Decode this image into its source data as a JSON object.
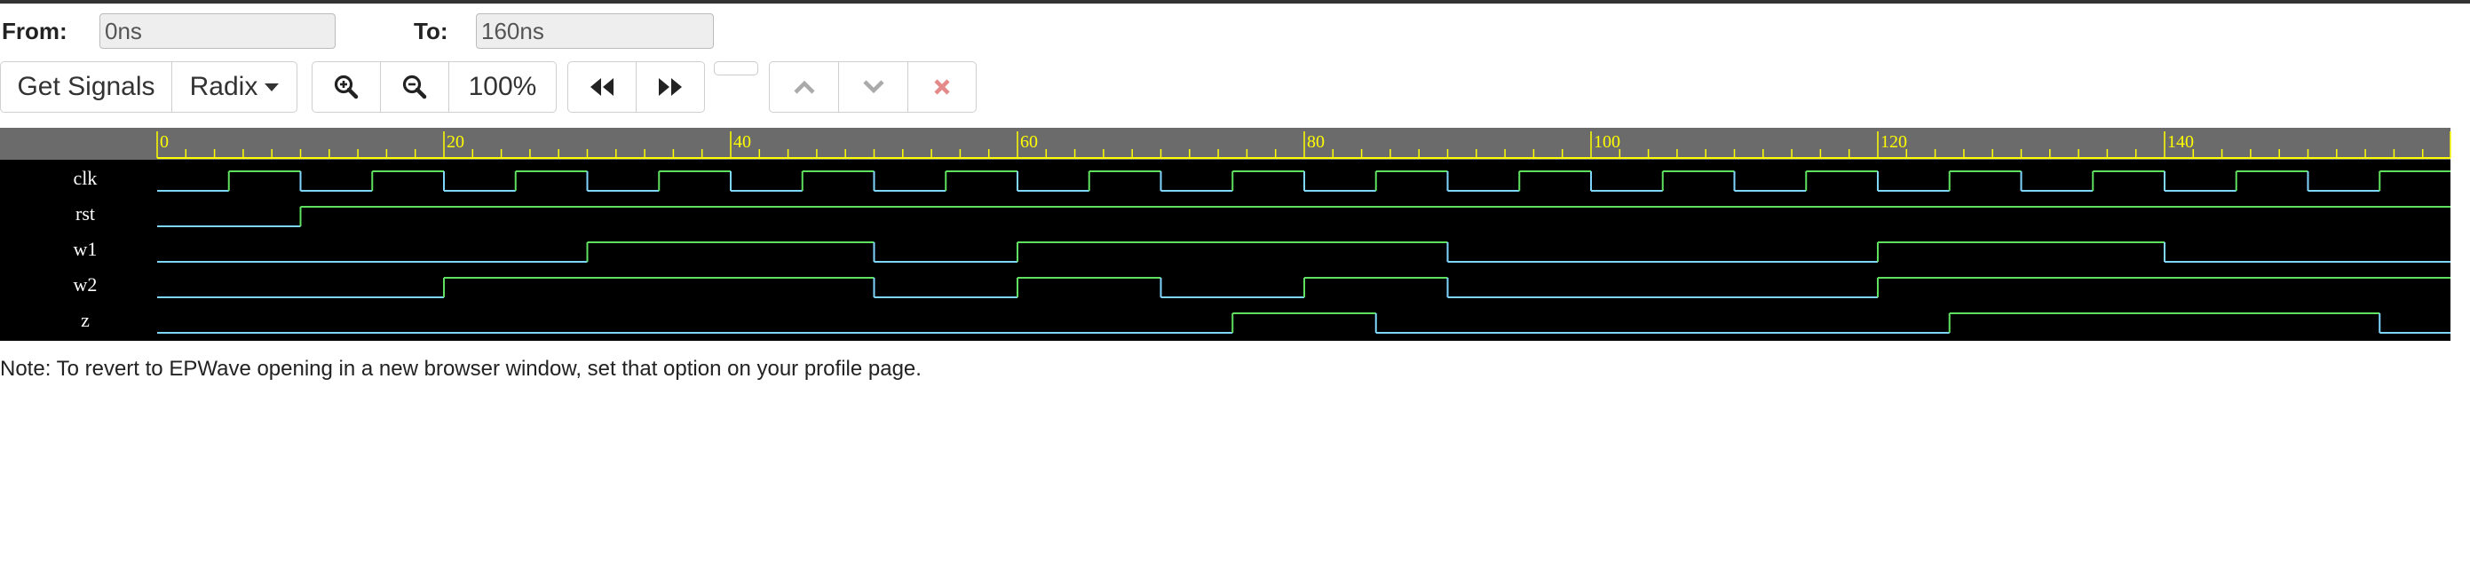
{
  "range": {
    "from_label": "From:",
    "from_value": "0ns",
    "to_label": "To:",
    "to_value": "160ns"
  },
  "toolbar": {
    "get_signals_label": "Get Signals",
    "radix_label": "Radix",
    "zoom_level": "100%",
    "icons": {
      "zoom_in": "zoom-in-icon",
      "zoom_out": "zoom-out-icon",
      "rewind": "fast-backward-icon",
      "forward": "fast-forward-icon",
      "prev": "chevron-up-icon",
      "next": "chevron-down-icon",
      "clear": "close-icon"
    }
  },
  "waveform": {
    "time_unit": "ns",
    "time_end": 160,
    "ruler_labels": [
      "0",
      "20",
      "40",
      "60",
      "80",
      "100",
      "120",
      "140"
    ],
    "colors": {
      "ruler_bg": "#6b6b6b",
      "ruler_text": "#ffff00",
      "low": "#7fd6ff",
      "high": "#5fe05f",
      "names": "#ffffff",
      "bg": "#000000"
    },
    "signals": [
      {
        "name": "clk",
        "transitions": [
          [
            0,
            0
          ],
          [
            5,
            1
          ],
          [
            10,
            0
          ],
          [
            15,
            1
          ],
          [
            20,
            0
          ],
          [
            25,
            1
          ],
          [
            30,
            0
          ],
          [
            35,
            1
          ],
          [
            40,
            0
          ],
          [
            45,
            1
          ],
          [
            50,
            0
          ],
          [
            55,
            1
          ],
          [
            60,
            0
          ],
          [
            65,
            1
          ],
          [
            70,
            0
          ],
          [
            75,
            1
          ],
          [
            80,
            0
          ],
          [
            85,
            1
          ],
          [
            90,
            0
          ],
          [
            95,
            1
          ],
          [
            100,
            0
          ],
          [
            105,
            1
          ],
          [
            110,
            0
          ],
          [
            115,
            1
          ],
          [
            120,
            0
          ],
          [
            125,
            1
          ],
          [
            130,
            0
          ],
          [
            135,
            1
          ],
          [
            140,
            0
          ],
          [
            145,
            1
          ],
          [
            150,
            0
          ],
          [
            155,
            1
          ]
        ]
      },
      {
        "name": "rst",
        "transitions": [
          [
            0,
            0
          ],
          [
            10,
            1
          ]
        ]
      },
      {
        "name": "w1",
        "transitions": [
          [
            0,
            0
          ],
          [
            30,
            1
          ],
          [
            50,
            0
          ],
          [
            60,
            1
          ],
          [
            90,
            0
          ],
          [
            120,
            1
          ],
          [
            140,
            0
          ]
        ]
      },
      {
        "name": "w2",
        "transitions": [
          [
            0,
            0
          ],
          [
            20,
            1
          ],
          [
            50,
            0
          ],
          [
            60,
            1
          ],
          [
            70,
            0
          ],
          [
            80,
            1
          ],
          [
            90,
            0
          ],
          [
            120,
            1
          ]
        ]
      },
      {
        "name": "z",
        "transitions": [
          [
            0,
            0
          ],
          [
            75,
            1
          ],
          [
            85,
            0
          ],
          [
            125,
            1
          ],
          [
            155,
            0
          ]
        ]
      }
    ]
  },
  "note": "Note: To revert to EPWave opening in a new browser window, set that option on your profile page."
}
